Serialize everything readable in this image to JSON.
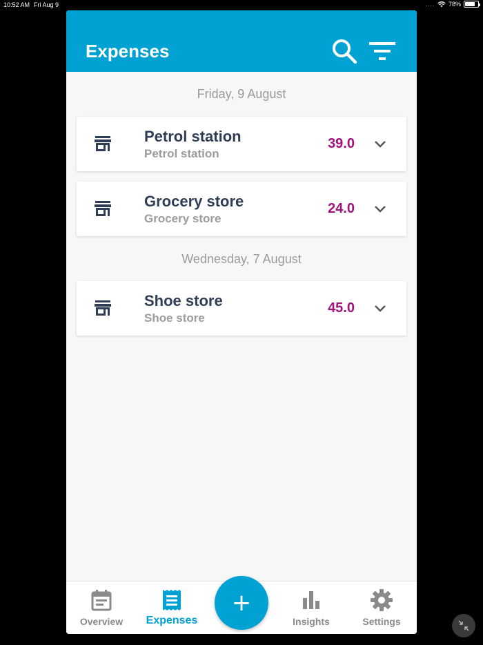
{
  "status_bar": {
    "time": "10:52 AM",
    "date": "Fri Aug 9",
    "signal": "....",
    "battery_percent": "78%",
    "battery_level": 0.78
  },
  "header": {
    "title": "Expenses",
    "search_icon": "search-icon",
    "filter_icon": "filter-icon"
  },
  "groups": [
    {
      "date": "Friday, 9 August",
      "items": [
        {
          "name": "Petrol station",
          "category": "Petrol station",
          "amount": "39.0",
          "icon": "store-icon"
        },
        {
          "name": "Grocery store",
          "category": "Grocery store",
          "amount": "24.0",
          "icon": "store-icon"
        }
      ]
    },
    {
      "date": "Wednesday, 7 August",
      "items": [
        {
          "name": "Shoe store",
          "category": "Shoe store",
          "amount": "45.0",
          "icon": "store-icon"
        }
      ]
    }
  ],
  "nav": {
    "items": [
      {
        "label": "Overview",
        "icon": "calendar-icon",
        "active": false
      },
      {
        "label": "Expenses",
        "icon": "receipt-icon",
        "active": true
      },
      {
        "label": "Insights",
        "icon": "bar-chart-icon",
        "active": false
      },
      {
        "label": "Settings",
        "icon": "gear-icon",
        "active": false
      }
    ],
    "fab_label": "+"
  },
  "colors": {
    "accent": "#00a1d3",
    "amount": "#a0127c",
    "title_text": "#2f3e56",
    "muted_text": "#9c9c9c"
  }
}
